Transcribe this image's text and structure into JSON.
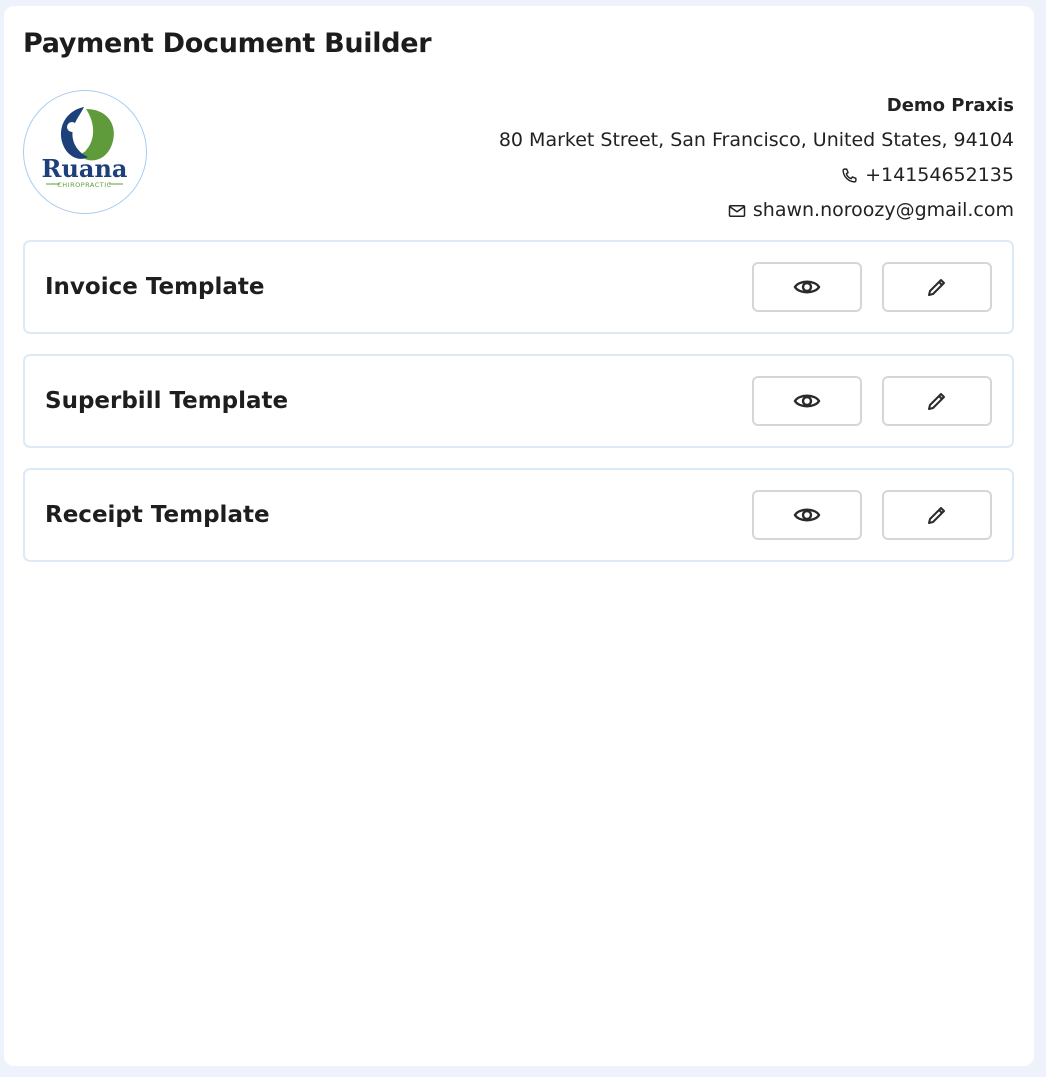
{
  "header": {
    "title": "Payment Document Builder"
  },
  "logo": {
    "icon": "ruana-chiropractic-logo",
    "brand_name": "Ruana",
    "brand_sub": "CHIROPRACTIC",
    "colors": {
      "navy": "#1d3f7a",
      "green": "#5f9b3b",
      "ring": "#a9cdef"
    }
  },
  "clinic": {
    "name": "Demo Praxis",
    "address": "80 Market Street, San Francisco, United States, 94104",
    "phone": "+14154652135",
    "phone_icon": "phone-icon",
    "email": "shawn.noroozy@gmail.com",
    "email_icon": "mail-icon"
  },
  "templates": [
    {
      "title": "Invoice Template",
      "view_icon": "eye-icon",
      "edit_icon": "pencil-icon"
    },
    {
      "title": "Superbill Template",
      "view_icon": "eye-icon",
      "edit_icon": "pencil-icon"
    },
    {
      "title": "Receipt Template",
      "view_icon": "eye-icon",
      "edit_icon": "pencil-icon"
    }
  ],
  "colors": {
    "background": "#eef3fb",
    "panel": "#ffffff",
    "card_border": "#dce9f7",
    "button_border": "#d6d6d6",
    "text": "#1e1e1e"
  }
}
